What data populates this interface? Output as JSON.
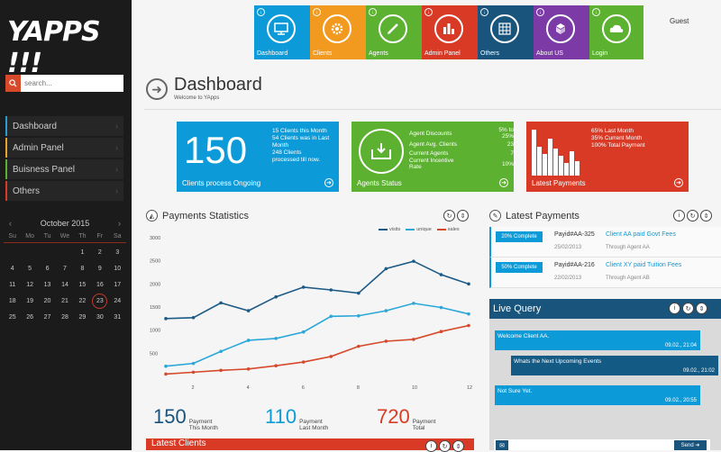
{
  "app": {
    "logo": "YAPPS !!!"
  },
  "search": {
    "placeholder": "search..."
  },
  "nav": [
    {
      "label": "Dashboard",
      "color": "#2a9bd4"
    },
    {
      "label": "Admin Panel",
      "color": "#e8a22a"
    },
    {
      "label": "Buisness Panel",
      "color": "#5cb130"
    },
    {
      "label": "Others",
      "color": "#d93a26"
    }
  ],
  "calendar": {
    "month": "October 2015",
    "prev": "‹",
    "next": "›",
    "dows": [
      "Su",
      "Mo",
      "Tu",
      "We",
      "Th",
      "Fr",
      "Sa"
    ],
    "weeks": [
      [
        "",
        "",
        "",
        "",
        "1",
        "2",
        "3"
      ],
      [
        "4",
        "5",
        "6",
        "7",
        "8",
        "9",
        "10"
      ],
      [
        "11",
        "12",
        "13",
        "14",
        "15",
        "16",
        "17"
      ],
      [
        "18",
        "19",
        "20",
        "21",
        "22",
        "23",
        "24"
      ],
      [
        "25",
        "26",
        "27",
        "28",
        "29",
        "30",
        "31"
      ]
    ],
    "today": "23"
  },
  "tiles": [
    {
      "label": "Dashboard",
      "color": "#0c9bd8",
      "icon": "monitor-icon"
    },
    {
      "label": "Clients",
      "color": "#f29a1f",
      "icon": "gear-icon"
    },
    {
      "label": "Agents",
      "color": "#5cb130",
      "icon": "pencil-icon"
    },
    {
      "label": "Admin Panel",
      "color": "#d93a26",
      "icon": "bar-chart-icon"
    },
    {
      "label": "Others",
      "color": "#18547c",
      "icon": "grid-icon"
    },
    {
      "label": "About US",
      "color": "#7b3aa6",
      "icon": "dropbox-icon"
    },
    {
      "label": "Login",
      "color": "#5cb130",
      "icon": "cloud-icon"
    }
  ],
  "header": {
    "user": "Guest"
  },
  "dashboard": {
    "title": "Dashboard",
    "subtitle": "Welcome to YApps"
  },
  "box1": {
    "big": "150",
    "notes": [
      "15 Clients this Month",
      "54 Clients was in Last",
      "Month",
      "248 Clients",
      "processed till now."
    ],
    "footer": "Clients process Ongoing"
  },
  "box2": {
    "rows": [
      {
        "label": "Agent Discounts",
        "value": "5% to 25%"
      },
      {
        "label": "Agent Avg. Clients",
        "value": "23"
      },
      {
        "label": "Current Agents",
        "value": "7"
      },
      {
        "label": "Current Incentive Rate",
        "value": "10%"
      }
    ],
    "footer": "Agents Status"
  },
  "box3": {
    "notes": [
      "65% Last Month",
      "35% Current Month",
      "100% Total Payment"
    ],
    "footer": "Latest Payments",
    "bars": [
      0.95,
      0.6,
      0.45,
      0.75,
      0.55,
      0.4,
      0.25,
      0.5,
      0.3
    ]
  },
  "payments_stats": {
    "title": "Payments Statistics"
  },
  "chart_data": {
    "type": "line",
    "x": [
      1,
      2,
      3,
      4,
      5,
      6,
      7,
      8,
      9,
      10,
      11,
      12
    ],
    "series": [
      {
        "name": "visits",
        "color": "#1c5a86",
        "values": [
          1250,
          1270,
          1590,
          1420,
          1720,
          1930,
          1870,
          1800,
          2330,
          2490,
          2200,
          2000
        ]
      },
      {
        "name": "unique",
        "color": "#2aa7d9",
        "values": [
          220,
          280,
          540,
          780,
          820,
          960,
          1300,
          1310,
          1420,
          1580,
          1490,
          1350
        ]
      },
      {
        "name": "sales",
        "color": "#d64a2b",
        "values": [
          50,
          90,
          130,
          160,
          230,
          310,
          430,
          650,
          760,
          800,
          970,
          1100
        ]
      }
    ],
    "yticks": [
      500,
      1000,
      1500,
      2000,
      2500,
      3000
    ],
    "xticks": [
      2,
      4,
      6,
      8,
      10,
      12
    ],
    "ylim": [
      0,
      3000
    ]
  },
  "summary": [
    {
      "num": "150",
      "l1": "Payment",
      "l2": "This Month",
      "color": "#18547c"
    },
    {
      "num": "110",
      "l1": "Payment",
      "l2": "Last Month",
      "color": "#0c9bd8"
    },
    {
      "num": "720",
      "l1": "Payment",
      "l2": "Total",
      "color": "#d93a26"
    }
  ],
  "latest_clients": {
    "title": "Latest Clients"
  },
  "latest_payments": {
    "title": "Latest Payments",
    "rows": [
      {
        "pct": "20% Complete",
        "id": "Payid#AA-325",
        "date": "25/02/2013",
        "desc": "Client AA paid Govt Fees",
        "by": "Through Agent AA"
      },
      {
        "pct": "50% Complete",
        "id": "Payid#AA-216",
        "date": "22/02/2013",
        "desc": "Client XY paid Tuition Fees",
        "by": "Through Agent AB"
      }
    ]
  },
  "live_query": {
    "title": "Live Query",
    "messages": [
      {
        "text": "Welcome Client AA.",
        "date": "09.02., 21:04"
      },
      {
        "text": "Whats the Next Upcoming Events",
        "date": "09.02., 21:02"
      },
      {
        "text": "Not Sure Yet.",
        "date": "09.02., 20:55"
      }
    ],
    "send": "Send"
  }
}
